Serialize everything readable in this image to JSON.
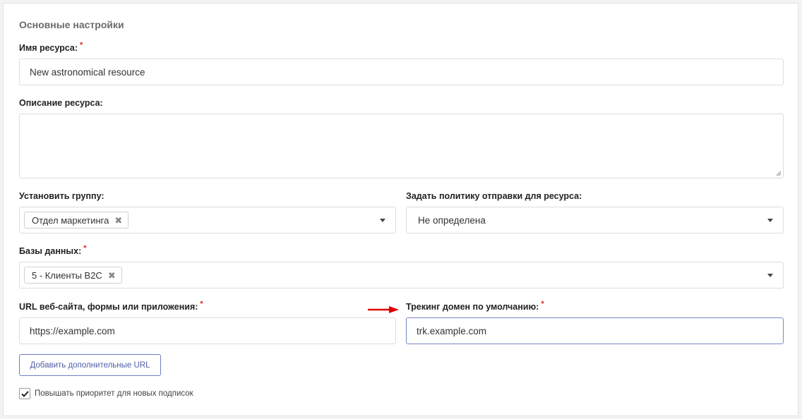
{
  "section": {
    "title": "Основные настройки"
  },
  "resource_name": {
    "label": "Имя ресурса:",
    "required_mark": "*",
    "value": "New astronomical resource"
  },
  "description": {
    "label": "Описание ресурса:",
    "value": ""
  },
  "group": {
    "label": "Установить группу:",
    "tag": "Отдел маркетинга"
  },
  "policy": {
    "label": "Задать политику отправки для ресурса:",
    "value": "Не определена"
  },
  "databases": {
    "label": "Базы данных:",
    "required_mark": "*",
    "tag": "5 - Клиенты B2C"
  },
  "url": {
    "label": "URL веб-сайта, формы или приложения:",
    "required_mark": "*",
    "value": "https://example.com"
  },
  "tracking": {
    "label": "Трекинг домен по умолчанию:",
    "required_mark": "*",
    "value": "trk.example.com"
  },
  "add_urls_button": {
    "label": "Добавить дополнительные URL"
  },
  "priority_checkbox": {
    "label": "Повышать приоритет для новых подписок",
    "checked": true
  },
  "colors": {
    "accent": "#4f5ea8",
    "required": "#e02424",
    "arrow": "#e00000"
  },
  "icons": {
    "remove_tag": "close-icon",
    "dropdown": "chevron-down-icon",
    "checkbox": "check-icon",
    "annotation": "arrow-right-icon"
  }
}
